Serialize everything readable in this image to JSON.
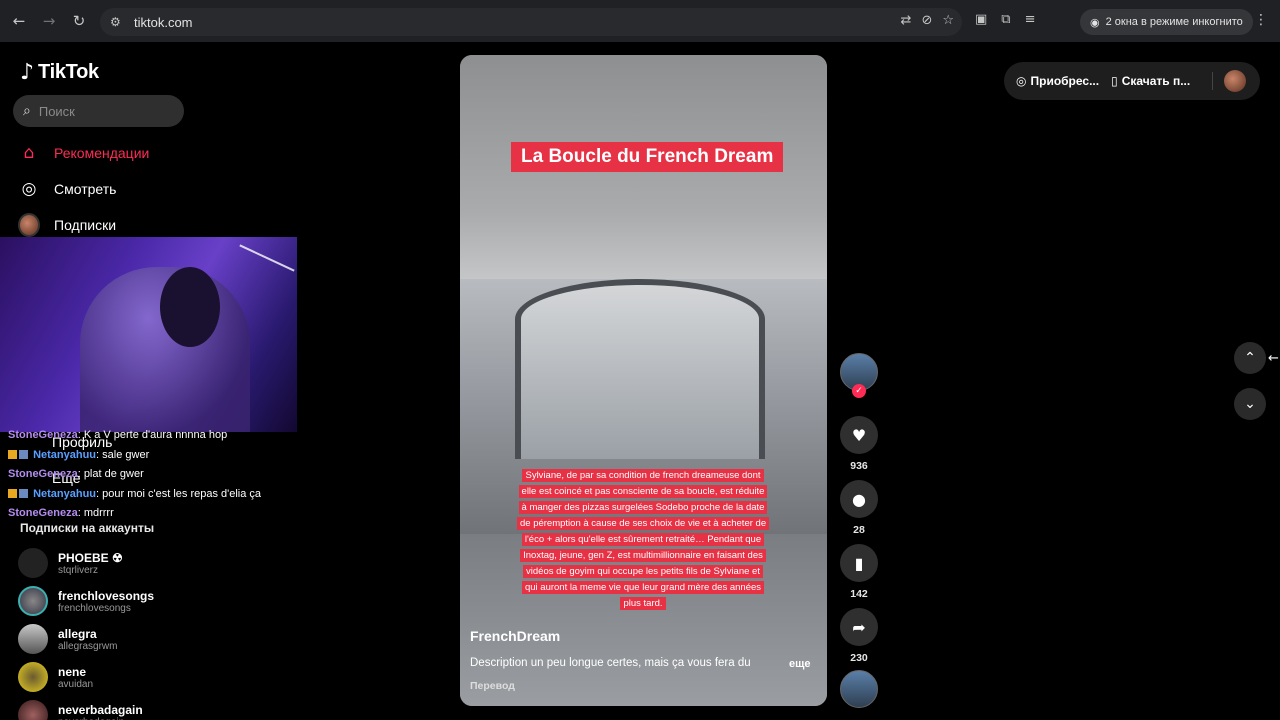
{
  "browser": {
    "url": "tiktok.com",
    "incognito_label": "2 окна в режиме инкогнито",
    "icons": [
      "back-icon",
      "forward-icon",
      "reload-icon",
      "site-info-icon",
      "translate-icon",
      "eye-off-icon",
      "star-icon",
      "extension-icon",
      "puzzle-icon",
      "media-icon",
      "incognito-icon",
      "kebab-menu-icon"
    ]
  },
  "sidebar": {
    "logo": "TikTok",
    "search_placeholder": "Поиск",
    "items": [
      {
        "label": "Рекомендации",
        "icon": "home-icon",
        "active": true
      },
      {
        "label": "Смотреть",
        "icon": "compass-icon",
        "active": false
      },
      {
        "label": "Подписки",
        "icon": "avatar-icon",
        "active": false
      },
      {
        "label": "Профиль",
        "icon": "profile-icon",
        "active": false
      },
      {
        "label": "Еще",
        "icon": "more-icon",
        "active": false
      }
    ],
    "subscriptions_title": "Подписки на аккаунты",
    "accounts": [
      {
        "name": "PHOEBE ☢",
        "handle": "stqrliverz"
      },
      {
        "name": "frenchlovesongs",
        "handle": "frenchlovesongs"
      },
      {
        "name": "allegra",
        "handle": "allegrasgrwm"
      },
      {
        "name": "nene",
        "handle": "avuidan"
      },
      {
        "name": "neverbadagain",
        "handle": "neverbadagain"
      }
    ]
  },
  "chat": [
    {
      "user": "StoneGeneza",
      "msg": "K a V perte d'aura nnnna hop",
      "badges": false
    },
    {
      "user": "Netanyahuu",
      "msg": "sale gwer",
      "badges": true
    },
    {
      "user": "StoneGeneza",
      "msg": "plat de gwer",
      "badges": false
    },
    {
      "user": "Netanyahuu",
      "msg": "pour moi c'est les repas d'elia ça",
      "badges": true
    },
    {
      "user": "StoneGeneza",
      "msg": "mdrrrr",
      "badges": false
    }
  ],
  "video": {
    "title": "La Boucle du French Dream",
    "caption": "Sylviane, de par sa condition de french dreameuse dont elle est coincé et pas consciente de sa boucle, est réduite à manger des pizzas surgelées Sodebo proche de la date de péremption à cause de ses choix de vie et à acheter de l'éco + alors qu'elle est sûrement retraité… Pendant que Inoxtag, jeune, gen Z, est multimillionnaire en faisant des vidéos de goyim qui occupe les petits fils de Sylviane et qui auront la meme vie que leur grand mère des années plus tard.",
    "author": "FrenchDream",
    "description": "Description un peu longue certes, mais ça vous fera du",
    "more_label": "еще",
    "translate_label": "Перевод"
  },
  "actions": {
    "likes": "936",
    "comments": "28",
    "saves": "142",
    "shares": "230"
  },
  "top_right": {
    "buy_label": "Приобрес...",
    "download_label": "Скачать п..."
  },
  "colors": {
    "accent": "#fe2c55",
    "caption_bg": "#e73145"
  }
}
